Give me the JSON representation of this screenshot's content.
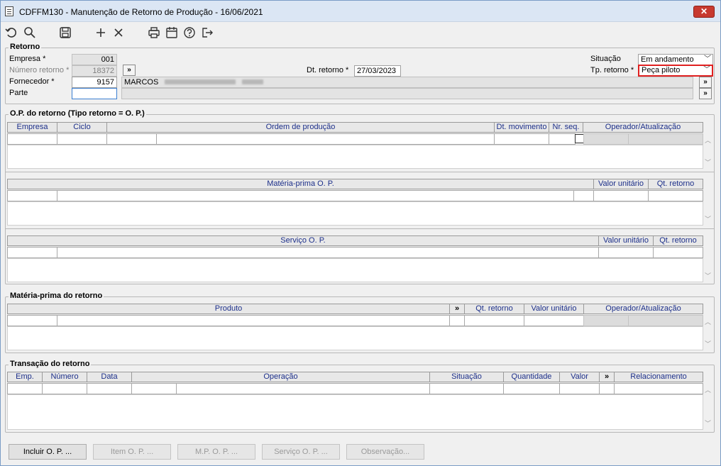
{
  "window": {
    "title": "CDFFM130 - Manutenção de Retorno de Produção - 16/06/2021",
    "close_label": "✕"
  },
  "toolbar": {
    "icons": [
      "undo-icon",
      "search-icon",
      "save-icon",
      "add-icon",
      "delete-icon",
      "print-icon",
      "calendar-icon",
      "help-icon",
      "exit-icon"
    ]
  },
  "retorno": {
    "title": "Retorno",
    "empresa_label": "Empresa *",
    "empresa_value": "001",
    "numero_label": "Número retorno *",
    "numero_value": "18372",
    "dt_label": "Dt. retorno *",
    "dt_value": "27/03/2023",
    "fornecedor_label": "Fornecedor *",
    "fornecedor_code": "9157",
    "fornecedor_name": "MARCOS",
    "parte_label": "Parte",
    "parte_value": "",
    "situacao_label": "Situação",
    "situacao_value": "Em andamento",
    "tp_label": "Tp. retorno *",
    "tp_value": "Peça piloto",
    "nav_label": "»"
  },
  "op": {
    "title": "O.P. do retorno (Tipo retorno = O. P.)",
    "headers": [
      "Empresa",
      "Ciclo",
      "Ordem de produção",
      "Dt. movimento",
      "Nr. seq.",
      "Operador/Atualização"
    ],
    "mp_headers": [
      "Matéria-prima O. P.",
      "Valor unitário",
      "Qt. retorno"
    ],
    "serv_headers": [
      "Serviço O. P.",
      "Valor unitário",
      "Qt. retorno"
    ]
  },
  "mp_retorno": {
    "title": "Matéria-prima do retorno",
    "headers": [
      "Produto",
      "»",
      "Qt. retorno",
      "Valor unitário",
      "Operador/Atualização"
    ]
  },
  "transacao": {
    "title": "Transação do retorno",
    "headers": [
      "Emp.",
      "Número",
      "Data",
      "Operação",
      "Situação",
      "Quantidade",
      "Valor",
      "»",
      "Relacionamento"
    ]
  },
  "buttons": {
    "incluir": "Incluir O. P. ...",
    "item": "Item O. P. ...",
    "mp": "M.P. O. P. ...",
    "servico": "Serviço O. P. ...",
    "observacao": "Observação..."
  }
}
